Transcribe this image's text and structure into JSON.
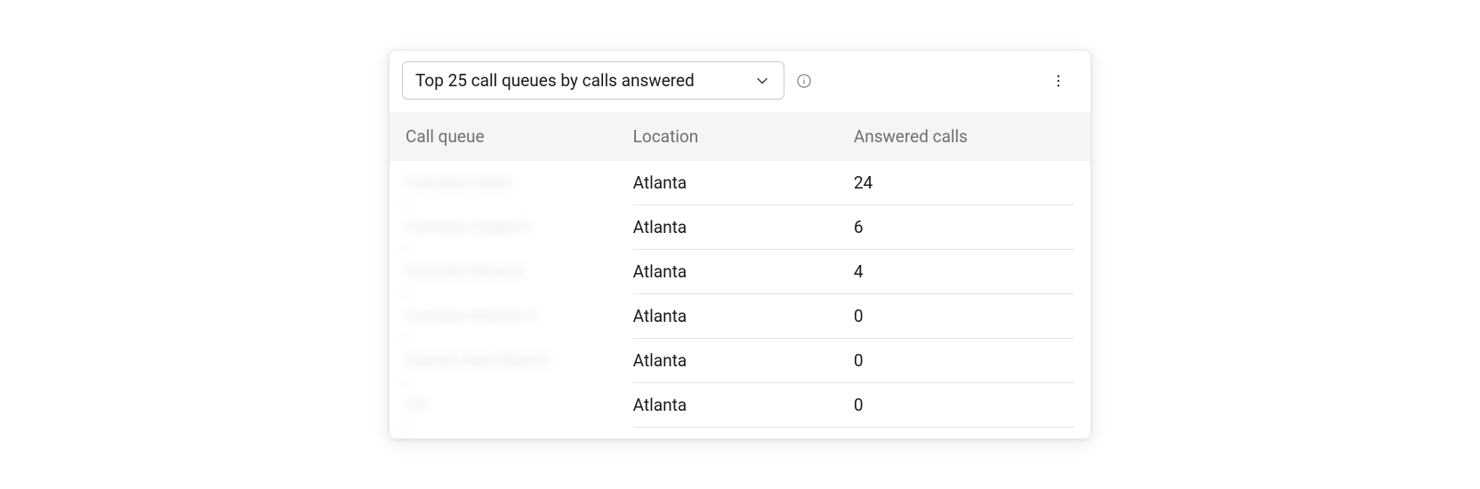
{
  "dropdown": {
    "selected_label": "Top 25 call queues by calls answered"
  },
  "table": {
    "columns": {
      "queue": "Call queue",
      "location": "Location",
      "answered": "Answered calls"
    },
    "rows": [
      {
        "queue": "Cumulus Sales",
        "location": "Atlanta",
        "answered": "24"
      },
      {
        "queue": "Cumulus Support",
        "location": "Atlanta",
        "answered": "6"
      },
      {
        "queue": "Cumulus Branch",
        "location": "Atlanta",
        "answered": "4"
      },
      {
        "queue": "Cumulus Branch 2",
        "location": "Atlanta",
        "answered": "0"
      },
      {
        "queue": "Cumuls New Branch",
        "location": "Atlanta",
        "answered": "0"
      },
      {
        "queue": "CQ",
        "location": "Atlanta",
        "answered": "0"
      }
    ]
  }
}
